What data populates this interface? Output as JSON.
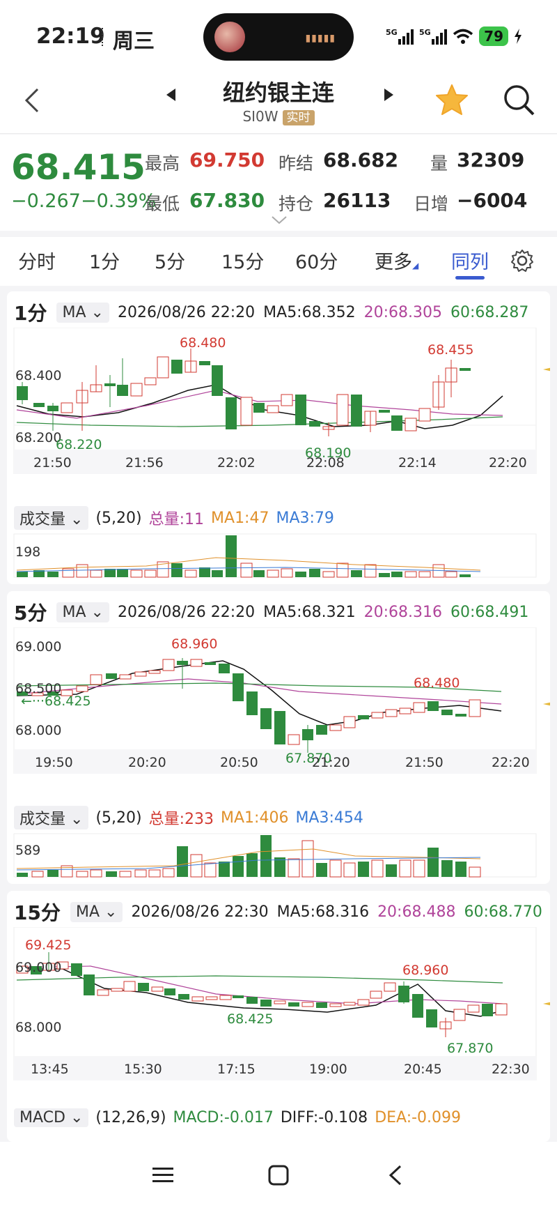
{
  "status_bar": {
    "time": "22:19",
    "weekday": "周三",
    "network": "5G 5G",
    "battery": "79"
  },
  "header": {
    "title": "纽约银主连",
    "code": "SI0W",
    "badge": "实时"
  },
  "quote": {
    "price": "68.415",
    "change": "−0.267",
    "change_pct": "−0.39%",
    "high_label": "最高",
    "high": "69.750",
    "low_label": "最低",
    "low": "67.830",
    "prev_settle_label": "昨结",
    "prev_settle": "68.682",
    "oi_label": "持仓",
    "oi": "26113",
    "volume_label": "量",
    "volume": "32309",
    "daily_inc_label": "日增",
    "daily_inc": "−6004"
  },
  "tabs": [
    "分时",
    "1分",
    "5分",
    "15分",
    "60分",
    "更多",
    "同列"
  ],
  "colors": {
    "up": "#d23a32",
    "down": "#2e8b3e",
    "ma5": "#111111",
    "ma20": "#b0449a",
    "ma60": "#2e8b3e",
    "accent": "#3a5bcf"
  },
  "panel1": {
    "title": "1分",
    "ma": "MA",
    "datetime": "2026/08/26 22:20",
    "ma5": "MA5:68.352",
    "ma20": "20:68.305",
    "ma60": "60:68.287",
    "y_ticks": [
      "68.400",
      "68.200"
    ],
    "x_ticks": [
      "21:50",
      "21:56",
      "22:02",
      "22:08",
      "22:14",
      "22:20"
    ],
    "annotations": [
      "68.480",
      "68.220",
      "68.190",
      "68.455"
    ],
    "vol_label": "成交量",
    "vol_params": "(5,20)",
    "vol_total": "总量:11",
    "vol_ma1": "MA1:47",
    "vol_ma3": "MA3:79",
    "vol_tick": "198"
  },
  "panel2": {
    "title": "5分",
    "ma": "MA",
    "datetime": "2026/08/26 22:20",
    "ma5": "MA5:68.321",
    "ma20": "20:68.316",
    "ma60": "60:68.491",
    "y_ticks": [
      "69.000",
      "68.500",
      "68.000"
    ],
    "x_ticks": [
      "19:50",
      "20:20",
      "20:50",
      "21:20",
      "21:50",
      "22:20"
    ],
    "annotations": [
      "68.960",
      "68.425",
      "67.870",
      "68.480"
    ],
    "vol_label": "成交量",
    "vol_params": "(5,20)",
    "vol_total": "总量:233",
    "vol_ma1": "MA1:406",
    "vol_ma3": "MA3:454",
    "vol_tick": "589"
  },
  "panel3": {
    "title": "15分",
    "ma": "MA",
    "datetime": "2026/08/26 22:30",
    "ma5": "MA5:68.316",
    "ma20": "20:68.488",
    "ma60": "60:68.770",
    "y_ticks": [
      "69.000",
      "68.000"
    ],
    "x_ticks": [
      "13:45",
      "15:30",
      "17:15",
      "19:00",
      "20:45",
      "22:30"
    ],
    "annotations": [
      "69.425",
      "68.425",
      "68.960",
      "67.870"
    ],
    "macd_label": "MACD",
    "macd_params": "(12,26,9)",
    "macd": "MACD:-0.017",
    "diff": "DIFF:-0.108",
    "dea": "DEA:-0.099"
  },
  "icons": [
    "back-icon",
    "prev-arrow-icon",
    "next-arrow-icon",
    "star-icon",
    "search-icon",
    "gear-icon",
    "menu-icon",
    "home-icon",
    "nav-back-icon"
  ]
}
